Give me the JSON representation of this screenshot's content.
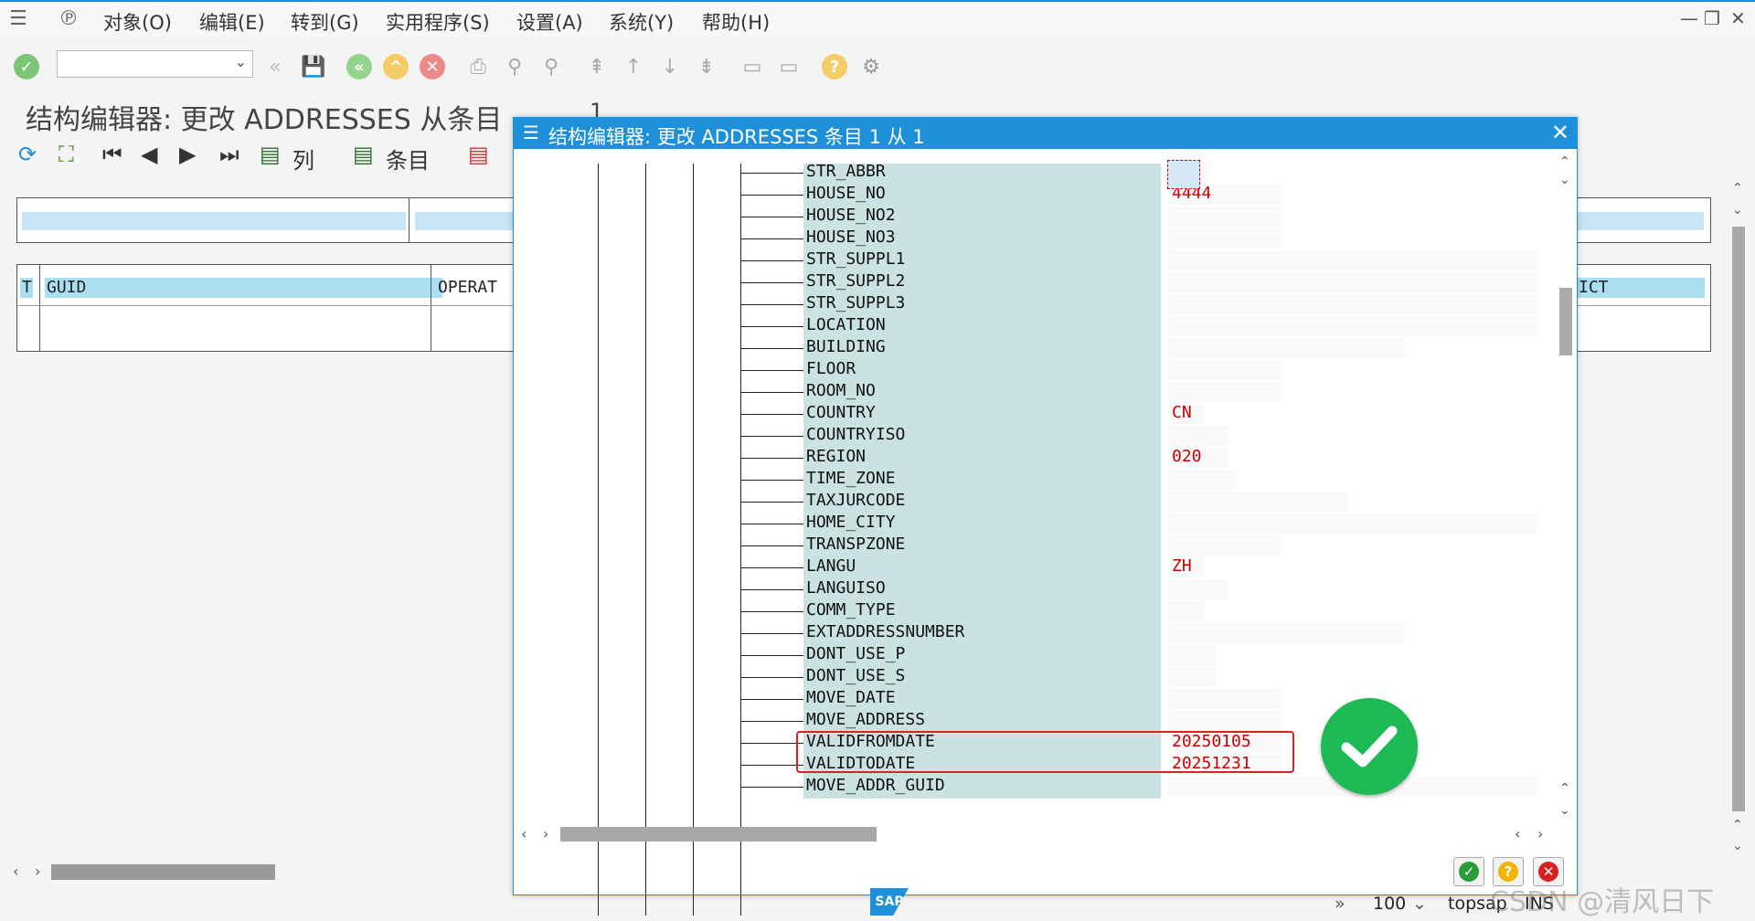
{
  "menubar": {
    "items": [
      "对象(O)",
      "编辑(E)",
      "转到(G)",
      "实用程序(S)",
      "设置(A)",
      "系统(Y)",
      "帮助(H)"
    ]
  },
  "page": {
    "title": "结构编辑器: 更改 ADDRESSES 从条目",
    "entry_number": "1"
  },
  "app_toolbar": {
    "col_label": "列",
    "entry_label": "条目"
  },
  "table": {
    "columns": [
      "T",
      "GUID",
      "OPERAT",
      "ICT"
    ]
  },
  "dialog": {
    "title": "结构编辑器: 更改 ADDRESSES 条目 1 从 1",
    "fields": [
      {
        "name": "STR_ABBR",
        "value": ""
      },
      {
        "name": "HOUSE_NO",
        "value": "4444"
      },
      {
        "name": "HOUSE_NO2",
        "value": ""
      },
      {
        "name": "HOUSE_NO3",
        "value": ""
      },
      {
        "name": "STR_SUPPL1",
        "value": ""
      },
      {
        "name": "STR_SUPPL2",
        "value": ""
      },
      {
        "name": "STR_SUPPL3",
        "value": ""
      },
      {
        "name": "LOCATION",
        "value": ""
      },
      {
        "name": "BUILDING",
        "value": ""
      },
      {
        "name": "FLOOR",
        "value": ""
      },
      {
        "name": "ROOM_NO",
        "value": ""
      },
      {
        "name": "COUNTRY",
        "value": "CN"
      },
      {
        "name": "COUNTRYISO",
        "value": ""
      },
      {
        "name": "REGION",
        "value": "020"
      },
      {
        "name": "TIME_ZONE",
        "value": ""
      },
      {
        "name": "TAXJURCODE",
        "value": ""
      },
      {
        "name": "HOME_CITY",
        "value": ""
      },
      {
        "name": "TRANSPZONE",
        "value": ""
      },
      {
        "name": "LANGU",
        "value": "ZH"
      },
      {
        "name": "LANGUISO",
        "value": ""
      },
      {
        "name": "COMM_TYPE",
        "value": ""
      },
      {
        "name": "EXTADDRESSNUMBER",
        "value": ""
      },
      {
        "name": "DONT_USE_P",
        "value": ""
      },
      {
        "name": "DONT_USE_S",
        "value": ""
      },
      {
        "name": "MOVE_DATE",
        "value": ""
      },
      {
        "name": "MOVE_ADDRESS",
        "value": ""
      },
      {
        "name": "VALIDFROMDATE",
        "value": "20250105"
      },
      {
        "name": "VALIDTODATE",
        "value": "20251231"
      },
      {
        "name": "MOVE_ADDR_GUID",
        "value": ""
      }
    ]
  },
  "status": {
    "zoom": "100",
    "server": "topsap",
    "mode": "INS",
    "watermark": "CSDN @清风日下"
  },
  "colors": {
    "accent": "#1e8fd9",
    "value_red": "#cc0000",
    "success_green": "#1db954",
    "field_bg": "#cbe2e2"
  }
}
